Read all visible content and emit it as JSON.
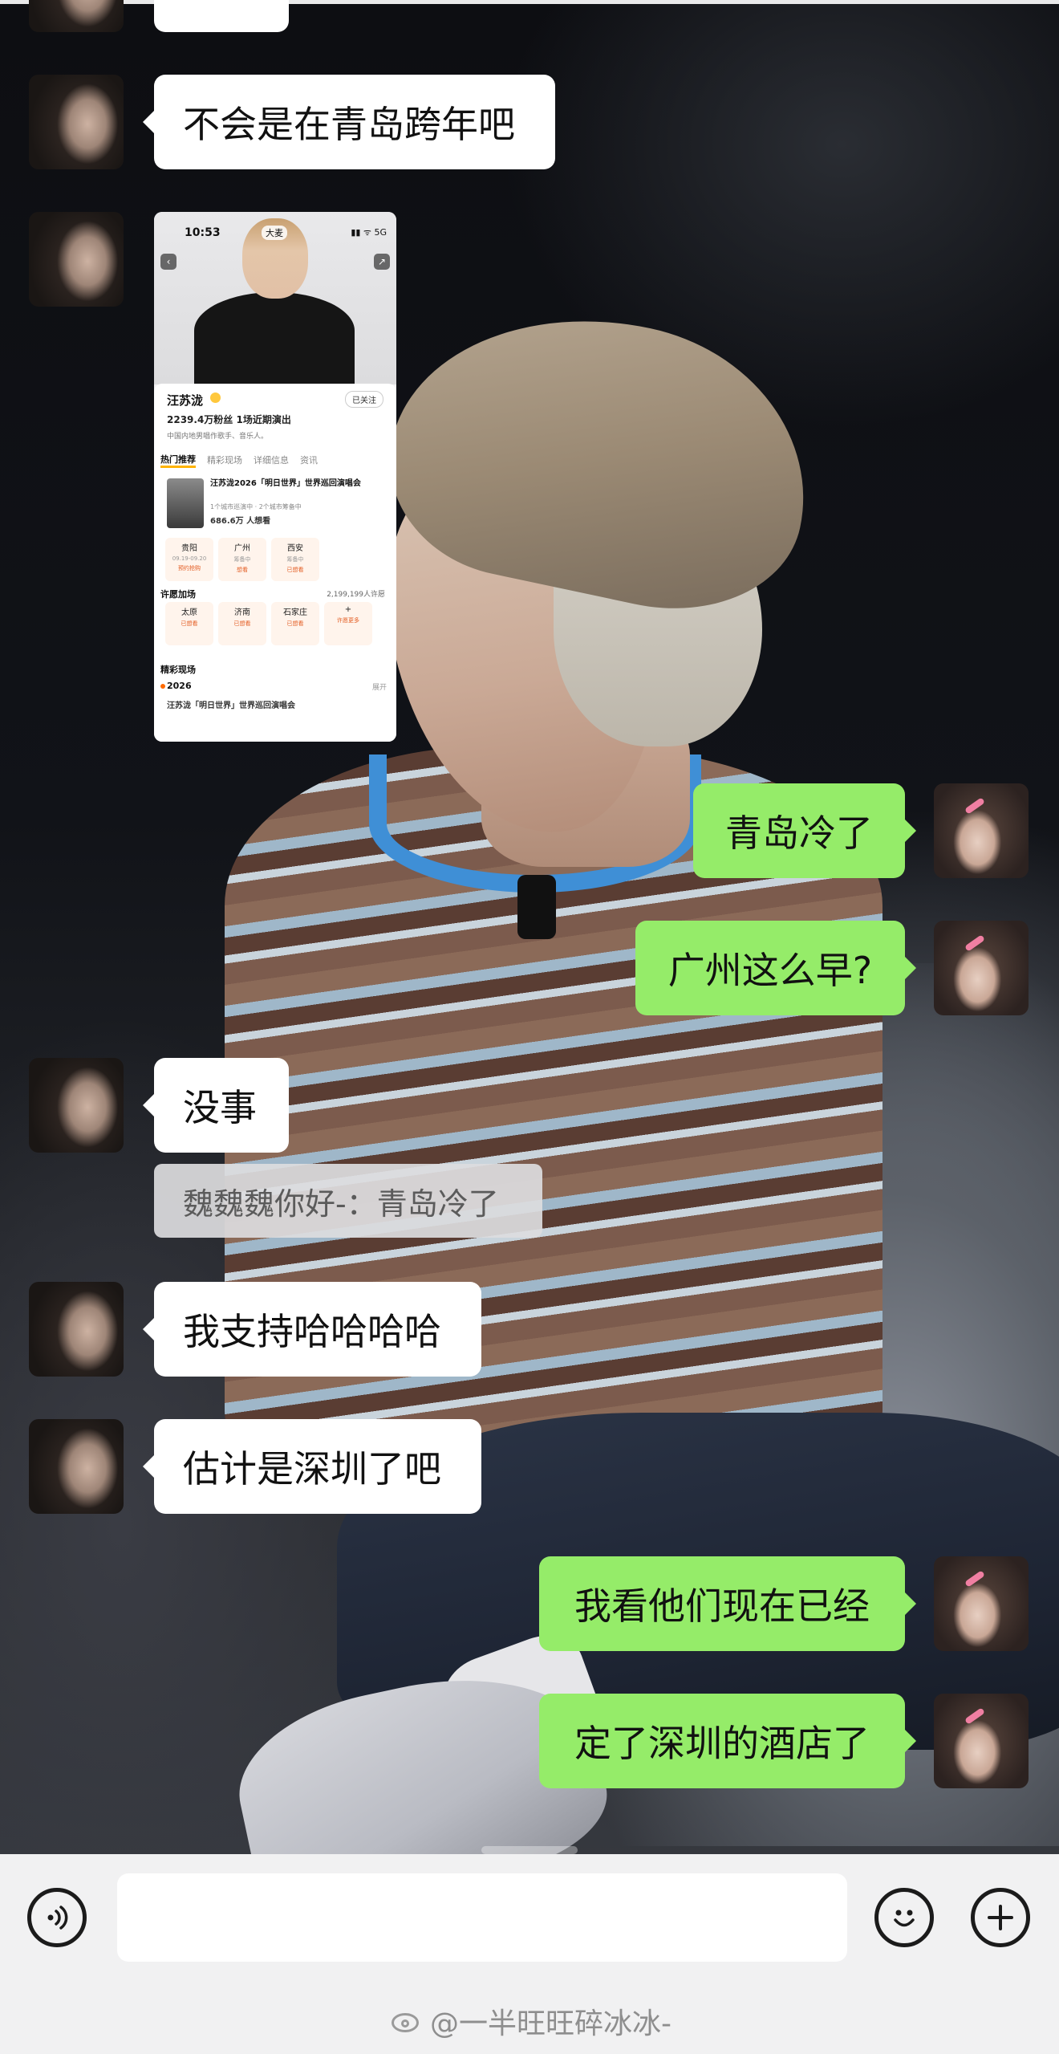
{
  "messages": [
    {
      "from": "friend",
      "text": "不会是在青岛跨年吧"
    },
    {
      "from": "friend",
      "type": "image",
      "caption": "shared ticket app screenshot"
    },
    {
      "from": "me",
      "text": "青岛冷了"
    },
    {
      "from": "me",
      "text": "广州这么早?"
    },
    {
      "from": "friend",
      "text": "没事"
    },
    {
      "from": "friend",
      "type": "quote",
      "text": "魏魏魏你好-：青岛冷了"
    },
    {
      "from": "friend",
      "text": "我支持哈哈哈哈"
    },
    {
      "from": "friend",
      "text": "估计是深圳了吧"
    },
    {
      "from": "me",
      "text": "我看他们现在已经"
    },
    {
      "from": "me",
      "text": "定了深圳的酒店了"
    }
  ],
  "shared_screenshot": {
    "time": "10:53",
    "status_icons": "▮▮ ᯤ 5G",
    "app_logo": "大麦",
    "artist": "汪苏泷",
    "follow_label": "已关注",
    "fans": "2239.4万粉丝  1场近期演出",
    "description": "中国内地男唱作歌手、音乐人。",
    "tabs": [
      "热门推荐",
      "精彩现场",
      "详细信息",
      "资讯"
    ],
    "event_title": "汪苏泷2026「明日世界」世界巡回演唱会",
    "event_sub": "1个城市巡演中 · 2个城市筹备中",
    "event_want": "686.6万 人想看",
    "cities": [
      {
        "name": "贵阳",
        "date": "09.19-09.20",
        "action": "预约抢购"
      },
      {
        "name": "广州",
        "date": "筹备中",
        "action": "想看"
      },
      {
        "name": "西安",
        "date": "筹备中",
        "action": "已想看"
      }
    ],
    "wish_section": "许愿加场",
    "wish_count": "2,199,199人许愿",
    "wish_cities": [
      {
        "name": "太原",
        "action": "已想看"
      },
      {
        "name": "济南",
        "action": "已想看"
      },
      {
        "name": "石家庄",
        "action": "已想看"
      },
      {
        "name": "+",
        "action": "许愿更多"
      }
    ],
    "live_section": "精彩现场",
    "year": "2026",
    "more": "展开",
    "clip_title": "汪苏泷「明日世界」世界巡回演唱会"
  },
  "input": {
    "value": ""
  },
  "watermark": "@一半旺旺碎冰冰-",
  "icons": {
    "voice": "voice-icon",
    "emoji": "emoji-icon",
    "plus": "plus-icon"
  },
  "colors": {
    "my_bubble": "#95ec69",
    "friend_bubble": "#ffffff",
    "input_bar": "#f1f1f2"
  }
}
